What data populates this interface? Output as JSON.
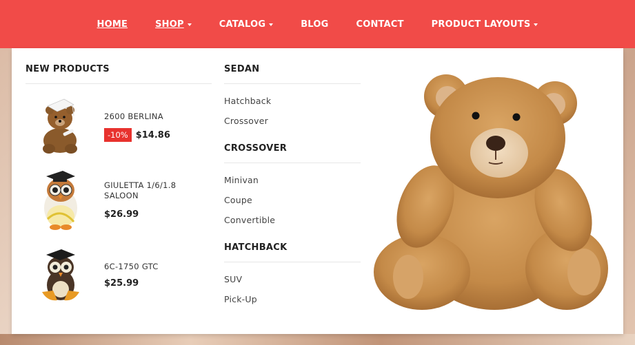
{
  "nav": {
    "items": [
      {
        "label": "HOME",
        "has_caret": false
      },
      {
        "label": "SHOP",
        "has_caret": true
      },
      {
        "label": "CATALOG",
        "has_caret": true
      },
      {
        "label": "BLOG",
        "has_caret": false
      },
      {
        "label": "CONTACT",
        "has_caret": false
      },
      {
        "label": "PRODUCT LAYOUTS",
        "has_caret": true
      }
    ]
  },
  "new_products": {
    "heading": "NEW PRODUCTS",
    "items": [
      {
        "name": "2600 BERLINA",
        "discount": "-10%",
        "price": "$14.86",
        "image": "teddy-bear-graduate"
      },
      {
        "name": "GIULETTA 1/6/1.8 SALOON",
        "price": "$26.99",
        "image": "owl-graduate-white"
      },
      {
        "name": "6C-1750 GTC",
        "price": "$25.99",
        "image": "owl-graduate-brown"
      }
    ]
  },
  "categories": [
    {
      "heading": "SEDAN",
      "links": [
        "Hatchback",
        "Crossover"
      ]
    },
    {
      "heading": "CROSSOVER",
      "links": [
        "Minivan",
        "Coupe",
        "Convertible"
      ]
    },
    {
      "heading": "HATCHBACK",
      "links": [
        "SUV",
        "Pick-Up"
      ]
    }
  ],
  "feature_image": {
    "icon": "teddy-bear-image"
  },
  "colors": {
    "nav_bg": "#f14b48",
    "badge": "#e8322e",
    "text": "#222222"
  }
}
